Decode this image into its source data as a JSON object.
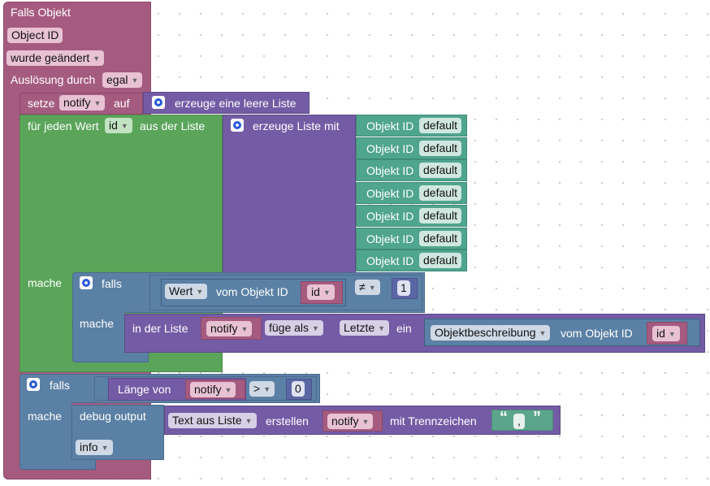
{
  "event": {
    "title": "Falls Objekt",
    "object_id": "Object ID",
    "change": "wurde geändert",
    "trigger_label": "Auslösung durch",
    "trigger_value": "egal"
  },
  "set_var": {
    "label": "setze",
    "var": "notify",
    "on": "auf",
    "create_empty": "erzeuge eine leere Liste"
  },
  "foreach": {
    "label": "für jeden Wert",
    "var": "id",
    "from": "aus der Liste",
    "do": "mache"
  },
  "create_list": {
    "label": "erzeuge Liste mit",
    "items": [
      {
        "label": "Objekt ID",
        "value": "default"
      },
      {
        "label": "Objekt ID",
        "value": "default"
      },
      {
        "label": "Objekt ID",
        "value": "default"
      },
      {
        "label": "Objekt ID",
        "value": "default"
      },
      {
        "label": "Objekt ID",
        "value": "default"
      },
      {
        "label": "Objekt ID",
        "value": "default"
      },
      {
        "label": "Objekt ID",
        "value": "default"
      }
    ]
  },
  "if1": {
    "label": "falls",
    "wert": "Wert",
    "from_obj": "vom Objekt ID",
    "id_var": "id",
    "op": "≠",
    "num": "1",
    "do": "mache"
  },
  "list_insert": {
    "in_list": "in der Liste",
    "var": "notify",
    "insert_as": "füge als",
    "position": "Letzte",
    "ein": "ein",
    "prop": "Objektbeschreibung",
    "from_obj": "vom Objekt ID",
    "id_var": "id"
  },
  "if2": {
    "label": "falls",
    "length_of": "Länge von",
    "var": "notify",
    "op": ">",
    "num": "0",
    "do": "mache"
  },
  "debug": {
    "label": "debug output",
    "text_from_list": "Text aus Liste",
    "create": "erstellen",
    "var": "notify",
    "with_sep": "mit Trennzeichen",
    "sep": ",",
    "level": "info"
  },
  "colors": {
    "event": "#a55b80",
    "variable": "#a55b80",
    "loop": "#5ba55b",
    "list": "#745ba5",
    "logic": "#5b80a5",
    "iobroker": "#4fa58d",
    "field_var": "#e8c2d3"
  }
}
